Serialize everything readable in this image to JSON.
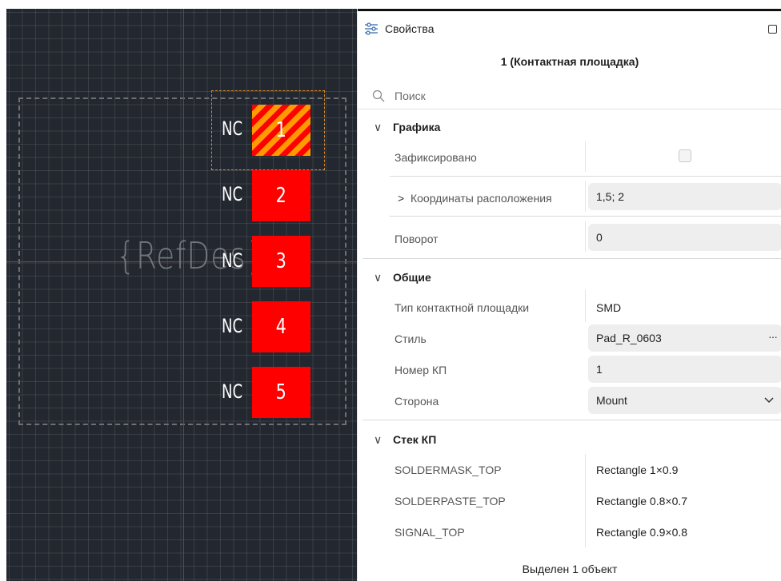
{
  "canvas": {
    "refdes": "{RefDes}",
    "pads": [
      {
        "number": "1",
        "net": "NC",
        "selected": true
      },
      {
        "number": "2",
        "net": "NC",
        "selected": false
      },
      {
        "number": "3",
        "net": "NC",
        "selected": false
      },
      {
        "number": "4",
        "net": "NC",
        "selected": false
      },
      {
        "number": "5",
        "net": "NC",
        "selected": false
      }
    ],
    "colors": {
      "background": "#232830",
      "pad": "#ff0000",
      "pad_selected_stripe": "#ff9a00",
      "axis": "#b3262b",
      "selection": "#d9892a"
    }
  },
  "panel": {
    "title": "Свойства",
    "title_icon": "sliders-icon",
    "object_title": "1 (Контактная площадка)",
    "search_placeholder": "Поиск",
    "sections": {
      "graphics": {
        "title": "Графика",
        "fixed_label": "Зафиксировано",
        "fixed_checked": false,
        "coords_label": "Координаты расположения",
        "coords_value": "1,5; 2",
        "rotation_label": "Поворот",
        "rotation_value": "0"
      },
      "general": {
        "title": "Общие",
        "pad_type_label": "Тип контактной площадки",
        "pad_type_value": "SMD",
        "style_label": "Стиль",
        "style_value": "Pad_R_0603",
        "style_more": "···",
        "pad_number_label": "Номер КП",
        "pad_number_value": "1",
        "side_label": "Сторона",
        "side_value": "Mount"
      },
      "stack": {
        "title": "Стек КП",
        "rows": [
          {
            "layer": "SOLDERMASK_TOP",
            "value": "Rectangle 1×0.9"
          },
          {
            "layer": "SOLDERPASTE_TOP",
            "value": "Rectangle 0.8×0.7"
          },
          {
            "layer": "SIGNAL_TOP",
            "value": "Rectangle 0.9×0.8"
          }
        ]
      }
    },
    "footer": "Выделен 1 объект"
  }
}
